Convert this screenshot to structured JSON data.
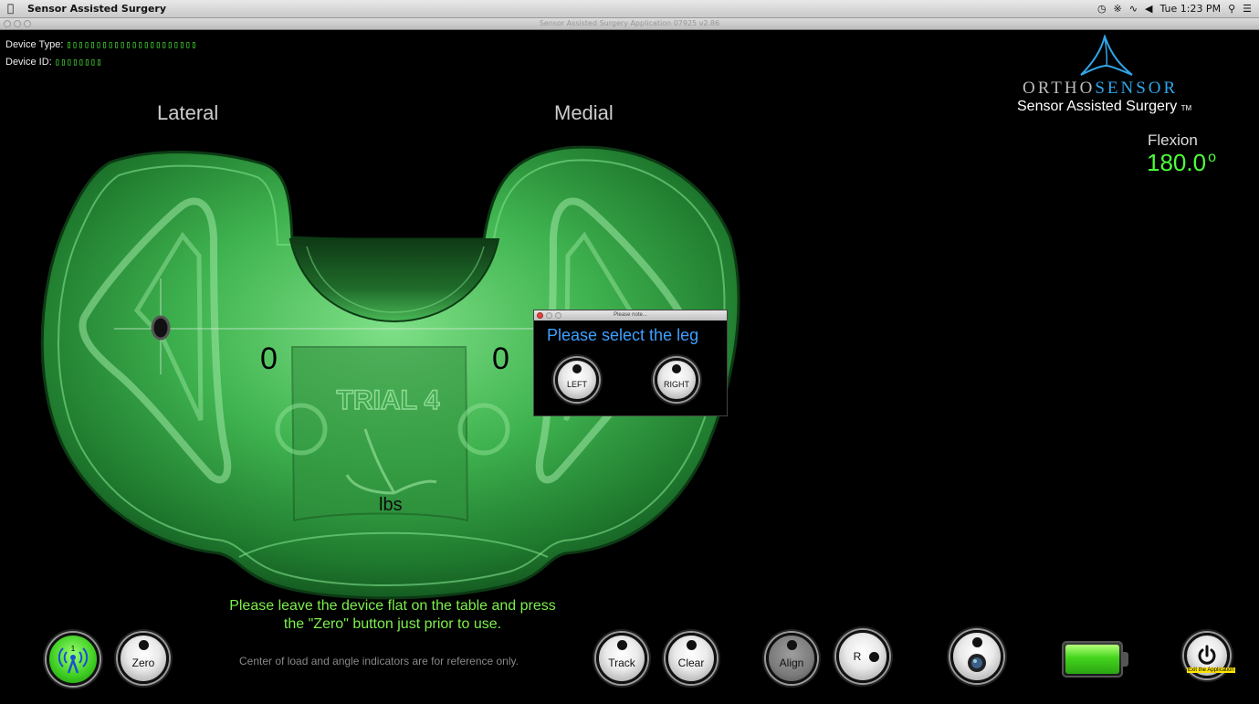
{
  "menubar": {
    "app_name": "Sensor Assisted Surgery",
    "clock": "Tue 1:23 PM"
  },
  "window": {
    "title": "Sensor Assisted Surgery Application 07925 v2.86"
  },
  "device": {
    "type_label": "Device Type:",
    "type_value": "▯▯▯▯▯▯▯▯▯▯▯▯▯▯▯▯▯▯▯▯▯▯",
    "id_label": "Device ID:",
    "id_value": "▯▯▯▯▯▯▯▯"
  },
  "brand": {
    "wordmark_a": "ORTHO",
    "wordmark_b": "SENSOR",
    "tagline": "Sensor Assisted Surgery",
    "tm": "TM"
  },
  "flexion": {
    "label": "Flexion",
    "value": "180.0",
    "unit": "o"
  },
  "tray": {
    "lateral_label": "Lateral",
    "medial_label": "Medial",
    "lateral_load": "0",
    "medial_load": "0",
    "unit": "lbs",
    "trial_label": "TRIAL 4"
  },
  "dialog": {
    "title": "Please note...",
    "prompt": "Please select the leg",
    "left_label": "LEFT",
    "right_label": "RIGHT"
  },
  "instructions": {
    "line1": "Please leave the device flat on the table and press",
    "line2": "the \"Zero\" button just prior to use.",
    "reference": "Center of load and angle indicators are for reference only."
  },
  "toolbar": {
    "wireless_badge": "1",
    "zero_label": "Zero",
    "track_label": "Track",
    "clear_label": "Clear",
    "align_label": "Align",
    "r_label": "R",
    "exit_tooltip": "Exit the Application"
  },
  "battery": {
    "level": 1.0
  },
  "colors": {
    "accent_green": "#4dff3a",
    "instruction_green": "#7cf04a",
    "dialog_blue": "#3ea0ff",
    "tray_green": "#2fa84a"
  }
}
